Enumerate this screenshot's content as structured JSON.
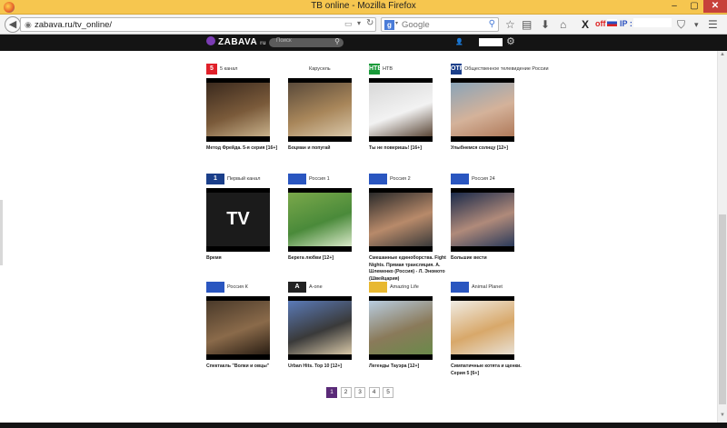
{
  "window": {
    "title": "ТВ online - Mozilla Firefox",
    "minimize": "–",
    "maximize": "▢",
    "close": "✕"
  },
  "toolbar": {
    "back_glyph": "◀",
    "url": "zabava.ru/tv_online/",
    "search_engine": "g",
    "search_placeholder": "Google",
    "off_label": "off",
    "ip_label": "IP :",
    "extension_x": "X",
    "icons": [
      "star-icon",
      "clipboard-icon",
      "download-icon",
      "home-icon",
      "x-extension-icon",
      "pocket-icon",
      "menu-icon"
    ]
  },
  "site": {
    "logo": "ZABAVA",
    "logo_suffix": "ru",
    "search_placeholder": "Поиск",
    "accent": "#5a2a78"
  },
  "channels": [
    {
      "channel": "5 канал",
      "caption": "Метод Фрейда. 5-я серия [16+]",
      "logo_color": "#e0202a",
      "logo_text": "5",
      "thumb": [
        "#3b2a1e",
        "#7a5a3a",
        "#c7b08a"
      ]
    },
    {
      "channel": "Карусель",
      "caption": "Боцман и попугай",
      "logo_color": "#ffffff",
      "logo_text": "",
      "thumb": [
        "#5a4a3a",
        "#a8865a",
        "#d8c6a8"
      ]
    },
    {
      "channel": "НТВ",
      "caption": "Ты не поверишь! [16+]",
      "logo_color": "#1a9a3a",
      "logo_text": "НТВ",
      "thumb": [
        "#d8d8d8",
        "#f2f2f2",
        "#5a4636"
      ]
    },
    {
      "channel": "Общественное телевидение России",
      "caption": "Улыбнемся солнцу [12+]",
      "logo_color": "#1b3f8a",
      "logo_text": "ОТР",
      "thumb": [
        "#8aa4b8",
        "#d4b29a",
        "#b07a5a"
      ]
    },
    {
      "channel": "Первый канал",
      "caption": "Время",
      "logo_color": "#1b3f8a",
      "logo_text": "1",
      "thumb": [
        "#111111",
        "#222222",
        "#111111"
      ]
    },
    {
      "channel": "Россия 1",
      "caption": "Берега любви [12+]",
      "logo_color": "#2a56c0",
      "logo_text": "",
      "thumb": [
        "#7aa84a",
        "#4a8a3a",
        "#d8e8c8"
      ]
    },
    {
      "channel": "Россия 2",
      "caption": "Смешанные единоборства. Fight Nights. Прямая трансляция. А. Шлеменко (Россия) - Л. Эномото (Швейцария)",
      "logo_color": "#2a56c0",
      "logo_text": "",
      "thumb": [
        "#2a2a2a",
        "#b88a6a",
        "#3a3a3a"
      ]
    },
    {
      "channel": "Россия 24",
      "caption": "Большие вести",
      "logo_color": "#2a56c0",
      "logo_text": "",
      "thumb": [
        "#1a2a4a",
        "#b08a7a",
        "#2a3a5a"
      ]
    },
    {
      "channel": "Россия К",
      "caption": "Спектакль \"Волки и овцы\"",
      "logo_color": "#2a56c0",
      "logo_text": "",
      "thumb": [
        "#4a3a2a",
        "#8a6a4a",
        "#2a1e14"
      ]
    },
    {
      "channel": "A-one",
      "caption": "Urban Hits. Top 10 [12+]",
      "logo_color": "#222222",
      "logo_text": "A",
      "thumb": [
        "#5a7ab8",
        "#3a3a3a",
        "#d8c8a8"
      ]
    },
    {
      "channel": "Amazing Life",
      "caption": "Легенды Тауэра [12+]",
      "logo_color": "#e8b830",
      "logo_text": "",
      "thumb": [
        "#b8cce0",
        "#8a7a5a",
        "#6a8a4a"
      ]
    },
    {
      "channel": "Animal Planet",
      "caption": "Симпатичные котята и щенки. Серия 5 [6+]",
      "logo_color": "#2a56c0",
      "logo_text": "",
      "thumb": [
        "#f0ece4",
        "#d8a86a",
        "#e8e0d4"
      ]
    }
  ],
  "pagination": {
    "pages": [
      "1",
      "2",
      "3",
      "4",
      "5"
    ],
    "active": "1"
  }
}
